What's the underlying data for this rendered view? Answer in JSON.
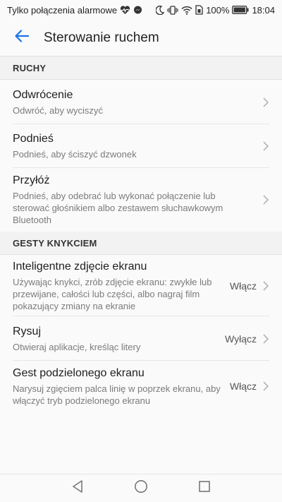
{
  "status_bar": {
    "carrier": "Tylko połączenia alarmowe",
    "battery_percent": "100%",
    "time": "18:04",
    "icons": [
      "heart-pulse-icon",
      "messenger-icon",
      "moon-icon",
      "vibrate-icon",
      "wifi-icon",
      "sim-icon",
      "battery-icon"
    ]
  },
  "app_bar": {
    "title": "Sterowanie ruchem",
    "back_icon": "arrow-left-icon",
    "accent_color": "#1a73e8"
  },
  "sections": [
    {
      "header": "RUCHY",
      "items": [
        {
          "title": "Odwrócenie",
          "subtitle": "Odwróć, aby wyciszyć",
          "value": ""
        },
        {
          "title": "Podnieś",
          "subtitle": "Podnieś, aby ściszyć dzwonek",
          "value": ""
        },
        {
          "title": "Przyłóż",
          "subtitle": "Podnieś, aby odebrać lub wykonać połączenie lub sterować głośnikiem albo zestawem słuchawkowym Bluetooth",
          "value": ""
        }
      ]
    },
    {
      "header": "GESTY KNYKCIEM",
      "items": [
        {
          "title": "Inteligentne zdjęcie ekranu",
          "subtitle": "Używając knykci, zrób zdjęcie ekranu: zwykłe lub przewijane, całości lub części, albo nagraj film pokazujący zmiany na ekranie",
          "value": "Włącz"
        },
        {
          "title": "Rysuj",
          "subtitle": "Otwieraj aplikacje, kreśląc litery",
          "value": "Wyłącz"
        },
        {
          "title": "Gest podzielonego ekranu",
          "subtitle": "Narysuj zgięciem palca linię w poprzek ekranu, aby włączyć tryb podzielonego ekranu",
          "value": "Włącz"
        }
      ]
    }
  ],
  "nav_bar": {
    "icons": [
      "back-triangle-icon",
      "home-circle-icon",
      "recents-square-icon"
    ]
  }
}
